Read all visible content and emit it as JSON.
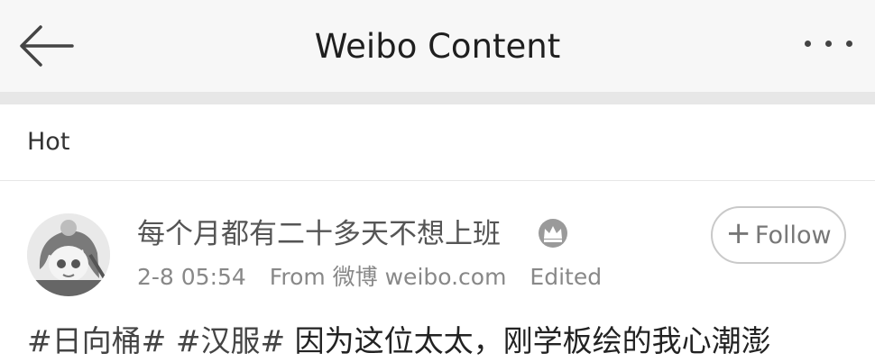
{
  "header": {
    "title": "Weibo Content",
    "back_icon": "arrow-left-icon",
    "more_icon": "more-dots-icon"
  },
  "tabs": {
    "hot": "Hot"
  },
  "post": {
    "username": "每个月都有二十多天不想上班",
    "badge_icon": "crown-icon",
    "time": "2-8 05:54",
    "source": "From 微博 weibo.com",
    "edited": "Edited",
    "follow_label": "Follow",
    "follow_icon": "plus-icon",
    "hashtags": [
      "#日向桶#",
      "#汉服#"
    ],
    "text": "因为这位太太，刚学板绘的我心潮澎"
  }
}
